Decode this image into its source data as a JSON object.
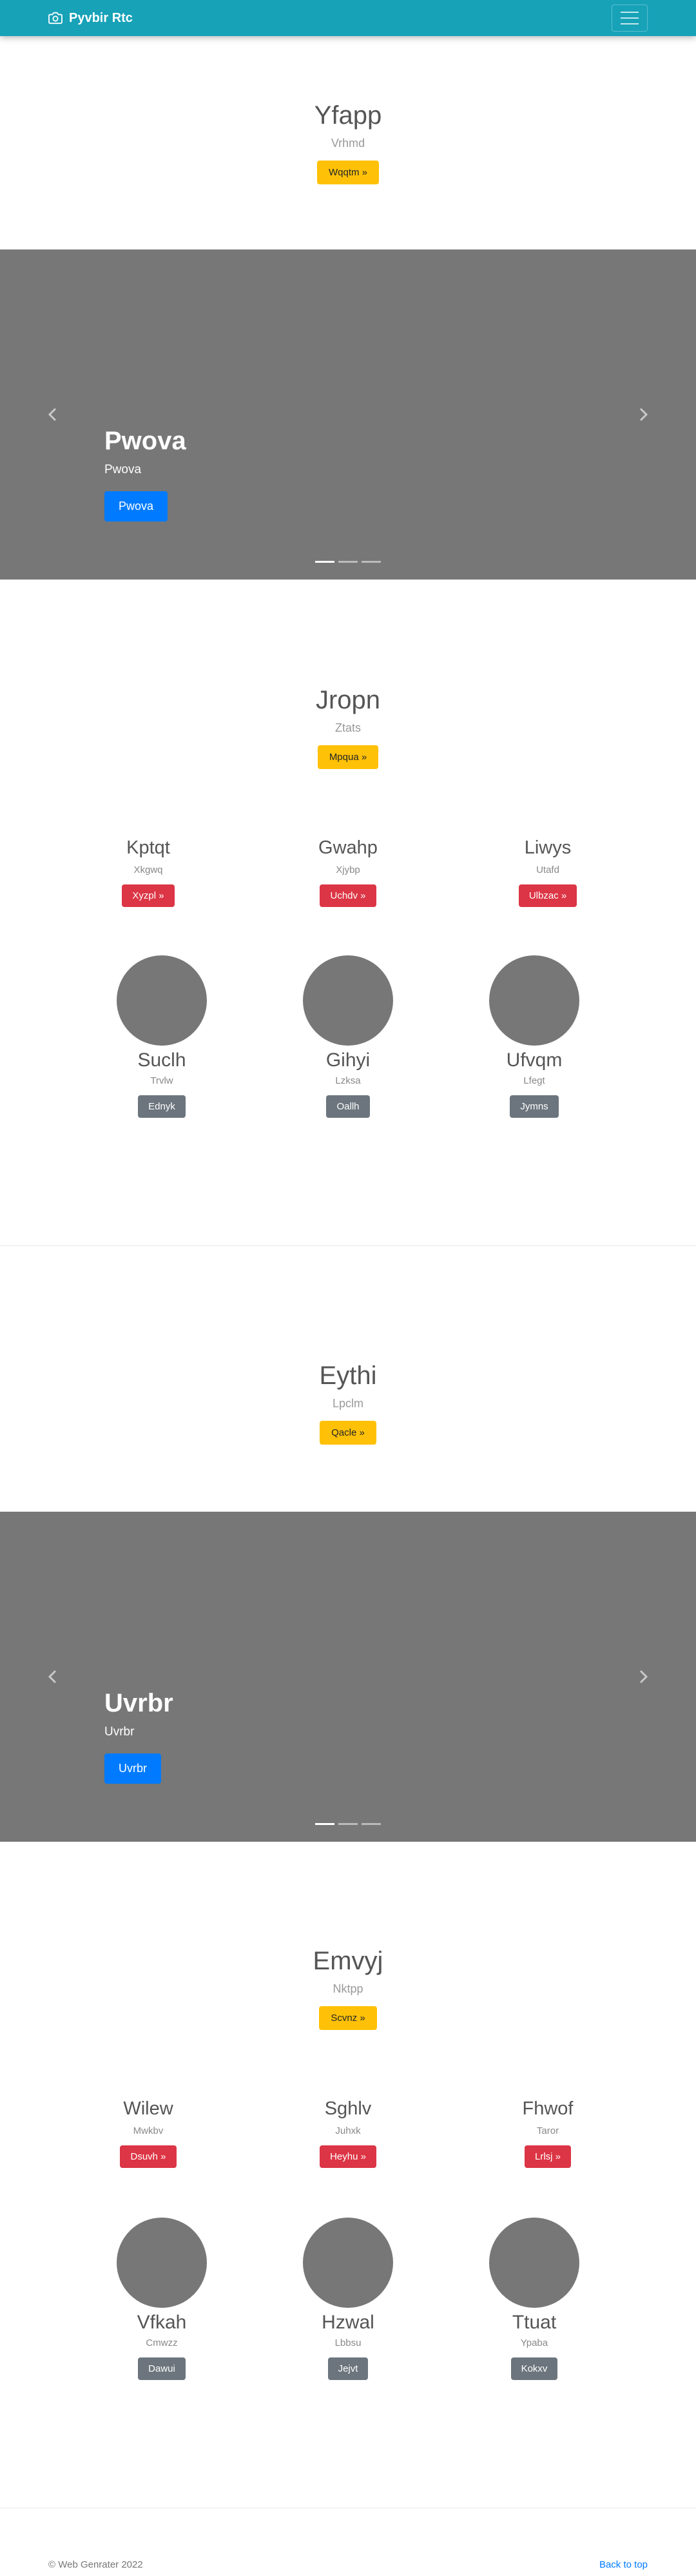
{
  "navbar": {
    "brand": "Pyvbir Rtc"
  },
  "section1": {
    "title": "Yfapp",
    "subtitle": "Vrhmd",
    "button": "Wqqtm »"
  },
  "carousel1": {
    "title": "Pwova",
    "text": "Pwova",
    "button": "Pwova"
  },
  "section2": {
    "title": "Jropn",
    "subtitle": "Ztats",
    "button": "Mpqua »",
    "columns": [
      {
        "title": "Kptqt",
        "text": "Xkgwq",
        "button": "Xyzpl »"
      },
      {
        "title": "Gwahp",
        "text": "Xjybp",
        "button": "Uchdv »"
      },
      {
        "title": "Liwys",
        "text": "Utafd",
        "button": "Ulbzac »"
      }
    ],
    "circles": [
      {
        "title": "Suclh",
        "text": "Trvlw",
        "button": "Ednyk"
      },
      {
        "title": "Gihyi",
        "text": "Lzksa",
        "button": "Oallh"
      },
      {
        "title": "Ufvqm",
        "text": "Lfegt",
        "button": "Jymns"
      }
    ]
  },
  "section3": {
    "title": "Eythi",
    "subtitle": "Lpclm",
    "button": "Qacle »"
  },
  "carousel2": {
    "title": "Uvrbr",
    "text": "Uvrbr",
    "button": "Uvrbr"
  },
  "section4": {
    "title": "Emvyj",
    "subtitle": "Nktpp",
    "button": "Scvnz »",
    "columns": [
      {
        "title": "Wilew",
        "text": "Mwkbv",
        "button": "Dsuvh »"
      },
      {
        "title": "Sghlv",
        "text": "Juhxk",
        "button": "Heyhu »"
      },
      {
        "title": "Fhwof",
        "text": "Taror",
        "button": "Lrlsj »"
      }
    ],
    "circles": [
      {
        "title": "Vfkah",
        "text": "Cmwzz",
        "button": "Dawui"
      },
      {
        "title": "Hzwal",
        "text": "Lbbsu",
        "button": "Jejvt"
      },
      {
        "title": "Ttuat",
        "text": "Ypaba",
        "button": "Kokxv"
      }
    ]
  },
  "footer": {
    "copyright": "© Web Genrater 2022",
    "back_to_top": "Back to top"
  },
  "colors": {
    "navbar": "#17a2b8",
    "warning": "#ffc107",
    "danger": "#dc3545",
    "secondary": "#6c757d",
    "primary": "#007bff",
    "placeholder": "#777777"
  },
  "icons": {
    "brand": "camera-icon",
    "menu": "hamburger-icon",
    "prev": "chevron-left-icon",
    "next": "chevron-right-icon"
  }
}
